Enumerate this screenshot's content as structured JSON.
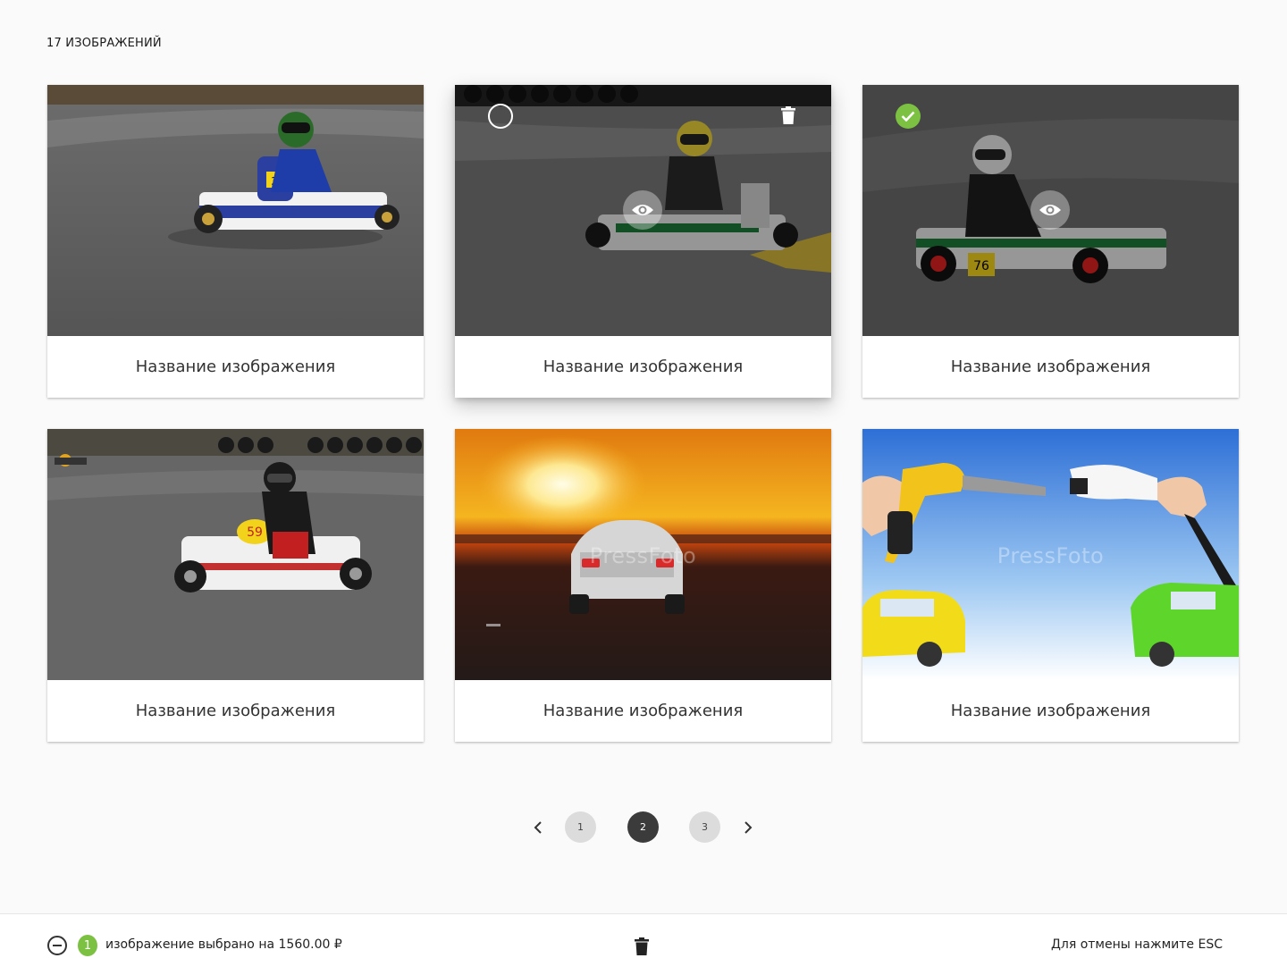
{
  "header": {
    "count_label": "17 ИЗОБРАЖЕНИЙ"
  },
  "cards": [
    {
      "title": "Название изображения",
      "scene": "kart-blue",
      "state": "normal"
    },
    {
      "title": "Название изображения",
      "scene": "kart-yellow-helmet",
      "state": "hover"
    },
    {
      "title": "Название изображения",
      "scene": "kart-green",
      "state": "selected"
    },
    {
      "title": "Название изображения",
      "scene": "kart-59",
      "state": "normal"
    },
    {
      "title": "Название изображения",
      "scene": "sunset-car",
      "state": "normal",
      "watermark": "PressFoto"
    },
    {
      "title": "Название изображения",
      "scene": "fuel-vs-electric",
      "state": "normal",
      "watermark": "PressFoto"
    }
  ],
  "pagination": {
    "pages": [
      "1",
      "2",
      "3"
    ],
    "current": "2",
    "prev_icon": "chevron-left-icon",
    "next_icon": "chevron-right-icon"
  },
  "bottom_bar": {
    "selected_count": "1",
    "selection_text": "изображение выбрано на 1560.00 ₽",
    "cancel_hint": "Для отмены нажмите ESC"
  },
  "colors": {
    "background": "#fafafa",
    "accent_green": "#7cc142",
    "active_page": "#3b3b3b",
    "inactive_page": "#dcdcdc"
  }
}
